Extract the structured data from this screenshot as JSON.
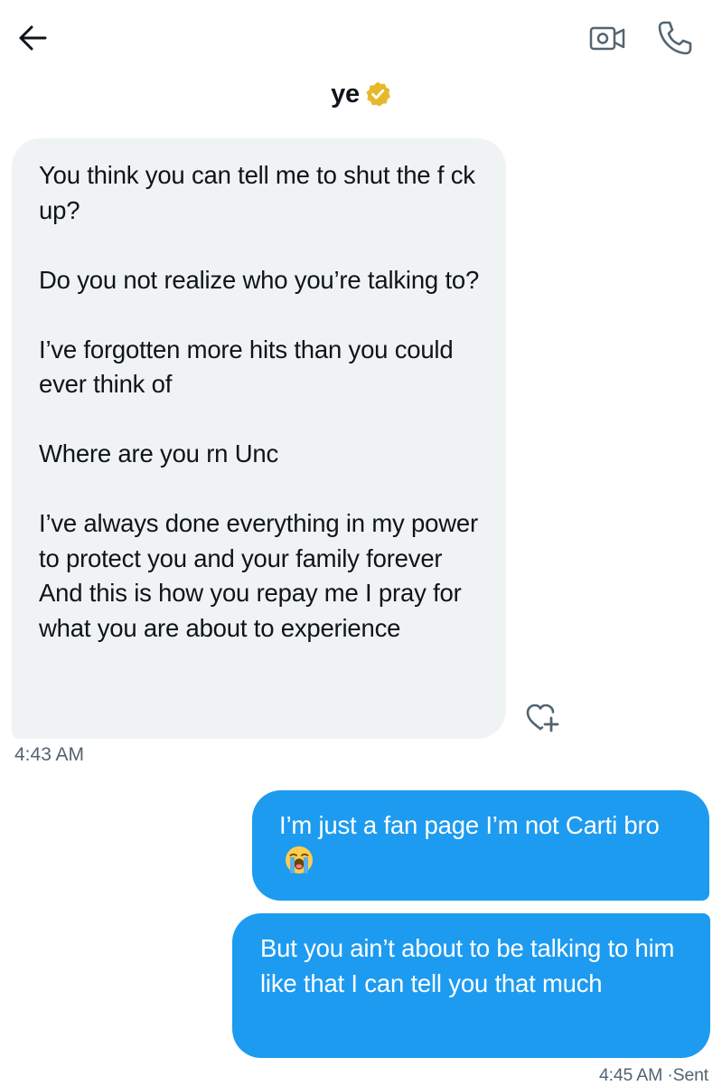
{
  "header": {
    "contact_name": "ye",
    "back_icon": "arrow-left-icon",
    "video_icon": "video-call-icon",
    "call_icon": "phone-icon",
    "verified_color": "#e8b82c"
  },
  "messages": {
    "received": {
      "paragraphs": [
        "You think you can tell me to shut the f   ck up?",
        "Do you not realize who you’re talking to?",
        "I’ve forgotten more hits than you could ever think of",
        "Where are you rn Unc",
        "I’ve always done everything in my power to protect you and your family forever     And this is how you repay me    I pray for what you are about to experience"
      ],
      "timestamp": "4:43 AM",
      "reaction_icon": "add-reaction-icon"
    },
    "sent": [
      {
        "text": "I’m just a fan page I’m not Carti bro",
        "emoji": "loudly-crying-face-emoji"
      },
      {
        "text": "But you ain’t about to be talking to him like that I can tell you that much"
      }
    ],
    "sent_timestamp": "4:45 AM",
    "sent_separator": "·",
    "sent_status": "Sent"
  },
  "colors": {
    "sent_bubble": "#1d9bf0",
    "received_bubble": "#eff3f4",
    "meta_text": "#536471"
  }
}
